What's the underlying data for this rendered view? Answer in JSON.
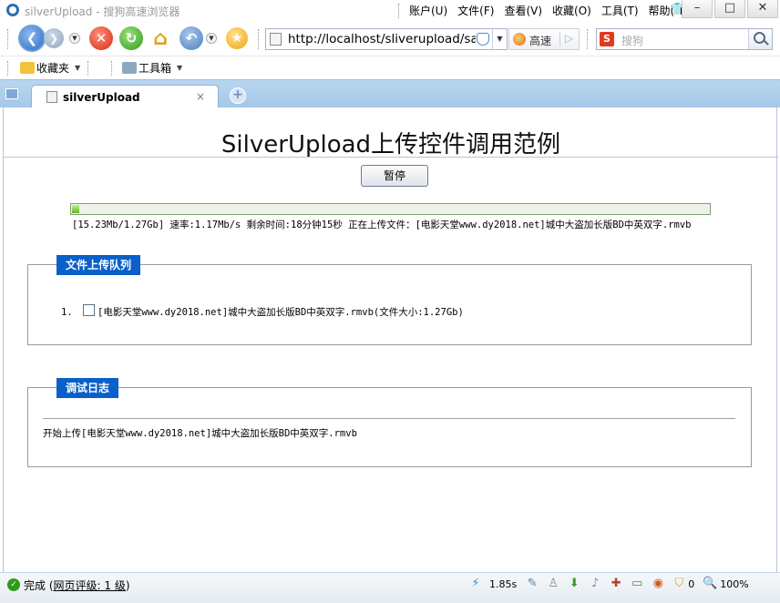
{
  "window": {
    "title": "silverUpload - 搜狗高速浏览器",
    "menu": [
      "账户(U)",
      "文件(F)",
      "查看(V)",
      "收藏(O)",
      "工具(T)",
      "帮助(H)"
    ]
  },
  "navbar": {
    "url": "http://localhost/sliverupload/sar",
    "speed_label": "高速",
    "search_placeholder": "搜狗"
  },
  "favbar": {
    "favorites_label": "收藏夹",
    "tools_label": "工具箱"
  },
  "tabs": [
    {
      "label": "silverUpload",
      "close": "×"
    }
  ],
  "page": {
    "title": "SilverUpload上传控件调用范例",
    "pause_label": "暂停",
    "progress_fraction": 0.012,
    "progress_text": "[15.23Mb/1.27Gb] 速率:1.17Mb/s 剩余时间:18分钟15秒 正在上传文件：[电影天堂www.dy2018.net]城中大盗加长版BD中英双字.rmvb",
    "queue": {
      "legend": "文件上传队列",
      "items": [
        {
          "index": "1.",
          "text": "[电影天堂www.dy2018.net]城中大盗加长版BD中英双字.rmvb(文件大小:1.27Gb)"
        }
      ]
    },
    "log": {
      "legend": "调试日志",
      "lines": [
        "开始上传[电影天堂www.dy2018.net]城中大盗加长版BD中英双字.rmvb"
      ]
    }
  },
  "status": {
    "done_label": "完成",
    "rating_prefix": "(",
    "rating_link": "网页评级: 1 级",
    "rating_suffix": ")",
    "load_time": "1.85s",
    "blocked_count": "0",
    "zoom": "100%"
  },
  "colors": {
    "legend_bg": "#0a60c9",
    "progress_fill": "#5fb52a",
    "tabbar_bg": "#b9d6ef"
  }
}
